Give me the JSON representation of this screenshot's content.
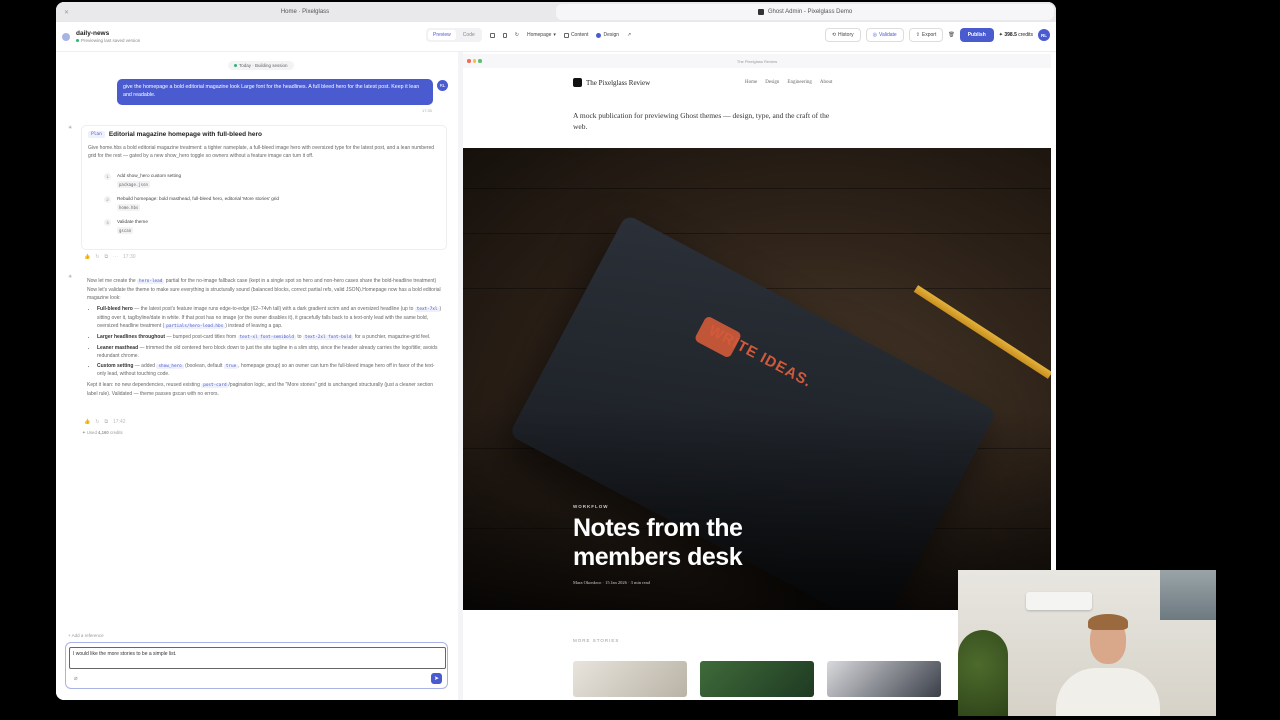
{
  "browser": {
    "tab_left": "Home · Pixelglass",
    "tab_right": "Ghost Admin - Pixelglass Demo"
  },
  "app": {
    "project_name": "daily-news",
    "project_status": "Previewing last saved version",
    "mode_preview": "Preview",
    "mode_code": "Code",
    "page_select": "Homepage",
    "tab_content": "Content",
    "tab_design": "Design",
    "history": "History",
    "validate": "Validate",
    "export": "Export",
    "publish": "Publish",
    "credits_value": "398.5",
    "credits_label": "credits",
    "avatar": "RL"
  },
  "chat": {
    "today": "Today · Building session",
    "user_message": "give the homepage a bold editorial magazine look Large font for the headlines. A full bleed hero for the latest post. Keep it lean and readable.",
    "user_time": "17:30",
    "plan_tag": "Plan",
    "plan_title": "Editorial magazine homepage with full-bleed hero",
    "plan_desc": "Give home.hbs a bold editorial magazine treatment: a tighter nameplate, a full-bleed image hero with oversized type for the latest post, and a lean numbered grid for the rest — gated by a new show_hero toggle so owners without a feature image can turn it off.",
    "steps": [
      {
        "n": "1",
        "label": "Add show_hero custom setting",
        "file": "package.json"
      },
      {
        "n": "2",
        "label": "Rebuild homepage: bold masthead, full-bleed hero, editorial 'More stories' grid",
        "file": "home.hbs"
      },
      {
        "n": "3",
        "label": "Validate theme",
        "file": "gscan"
      }
    ],
    "plan_time": "17:30",
    "response_intro_a": "Now let me create the",
    "response_intro_code": "hero-lead",
    "response_intro_b": "partial for the no-image fallback case (kept in a single spot so hero and non-hero cases share the bold-headline treatment) Now let's validate the theme to make sure everything is structurally sound (balanced blocks, correct partial refs, valid JSON).Homepage now has a bold editorial magazine look:",
    "bullets": [
      {
        "title": "Full-bleed hero",
        "text": "— the latest post's feature image runs edge-to-edge (62–74vh tall) with a dark gradient scrim and an oversized headline (up to",
        "code": "text-7xl",
        "text2": ") sitting over it, tag/byline/date in white. If that post has no image (or the owner disables it), it gracefully falls back to a text-only lead with the same bold, oversized headline treatment (",
        "code2": "partials/hero-lead.hbs",
        "text3": ") instead of leaving a gap."
      },
      {
        "title": "Larger headlines throughout",
        "text": "— bumped post-card titles from",
        "code": "text-xl font-semibold",
        "text2": "to",
        "code2": "text-2xl font-bold",
        "text3": "for a punchier, magazine-grid feel."
      },
      {
        "title": "Leaner masthead",
        "text": "— trimmed the old centered hero block down to just the site tagline in a slim strip, since the header already carries the logo/title; avoids redundant chrome.",
        "code": "",
        "text2": "",
        "code2": "",
        "text3": ""
      },
      {
        "title": "Custom setting",
        "text": "— added",
        "code": "show_hero",
        "text2": "(boolean, default",
        "code2": "true",
        "text3": ", homepage group) so an owner can turn the full-bleed image hero off in favor of the text-only lead, without touching code."
      }
    ],
    "outro_a": "Kept it lean: no new dependencies, reused existing",
    "outro_code": "post-card",
    "outro_b": "/pagination logic, and the \"More stories\" grid is unchanged structurally (just a cleaner section label rule). Validated — theme passes gscan with no errors.",
    "resp_time": "17:42",
    "used_label": "Used",
    "used_value": "4,160",
    "used_unit": "credits",
    "add_reference": "Add a reference",
    "composer_value": "I would like the more stories to be a simple list."
  },
  "preview": {
    "url": "The Pixelglass Review",
    "site_title": "The Pixelglass Review",
    "nav": [
      "Home",
      "Design",
      "Engineering",
      "About"
    ],
    "tagline": "A mock publication for previewing Ghost themes — design, type, and the craft of the web.",
    "hero_kicker": "WORKFLOW",
    "hero_title": "Notes from the members desk",
    "hero_author": "Mara Okonkwo",
    "hero_date": "15 Jan 2026",
    "hero_read": "3 min read",
    "more_label": "MORE STORIES",
    "book_text": "WRITE IDEAS."
  },
  "colors": {
    "accent": "#4a5bd0",
    "status_green": "#2bb673"
  }
}
